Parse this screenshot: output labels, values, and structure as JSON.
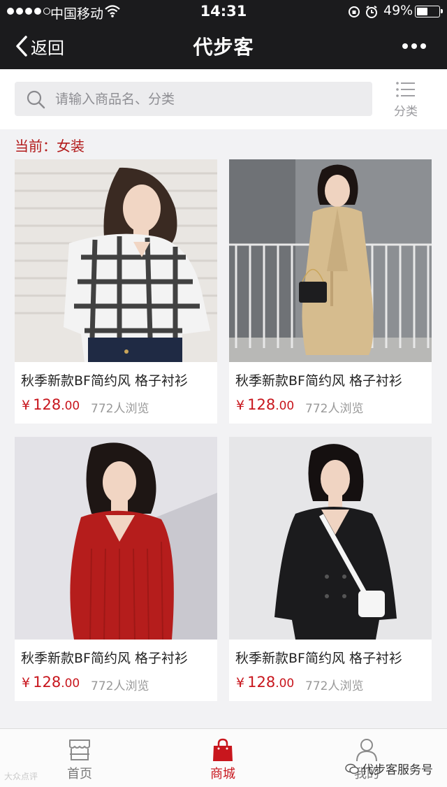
{
  "status_bar": {
    "carrier": "中国移动",
    "time": "14:31",
    "battery": "49%"
  },
  "nav": {
    "back_label": "返回",
    "title": "代步客"
  },
  "search": {
    "placeholder": "请输入商品名、分类",
    "category_label": "分类"
  },
  "current_label": "当前：女装",
  "products": [
    {
      "name": "秋季新款BF简约风 格子衬衫",
      "currency": "¥",
      "price_int": "128",
      "price_dec": ".00",
      "views": "772人浏览"
    },
    {
      "name": "秋季新款BF简约风 格子衬衫",
      "currency": "¥",
      "price_int": "128",
      "price_dec": ".00",
      "views": "772人浏览"
    },
    {
      "name": "秋季新款BF简约风 格子衬衫",
      "currency": "¥",
      "price_int": "128",
      "price_dec": ".00",
      "views": "772人浏览"
    },
    {
      "name": "秋季新款BF简约风 格子衬衫",
      "currency": "¥",
      "price_int": "128",
      "price_dec": ".00",
      "views": "772人浏览"
    }
  ],
  "tabs": [
    {
      "label": "首页",
      "icon": "store-icon",
      "active": false
    },
    {
      "label": "商城",
      "icon": "shopping-bag-icon",
      "active": true
    },
    {
      "label": "我的",
      "icon": "user-icon",
      "active": false
    }
  ],
  "watermark": {
    "left": "大众点评",
    "right": "代步客服务号"
  },
  "colors": {
    "accent": "#c8161d",
    "nav_bg": "#1b1b1d"
  }
}
